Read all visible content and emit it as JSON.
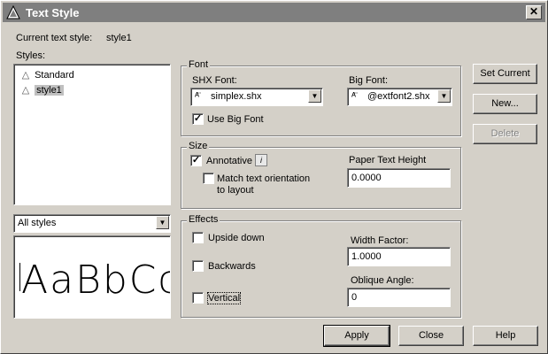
{
  "window": {
    "title": "Text Style"
  },
  "current": {
    "label": "Current text style:",
    "value": "style1"
  },
  "styles": {
    "label": "Styles:",
    "items": [
      {
        "label": "Standard"
      },
      {
        "label": "style1"
      }
    ],
    "filter_value": "All styles"
  },
  "preview": {
    "text": "AaBbCc"
  },
  "font": {
    "group_label": "Font",
    "shx_label": "SHX Font:",
    "shx_value": "simplex.shx",
    "big_label": "Big Font:",
    "big_value": "@extfont2.shx",
    "use_big_font_label": "Use Big Font",
    "use_big_font_checked": true
  },
  "size": {
    "group_label": "Size",
    "annotative_label": "Annotative",
    "annotative_checked": true,
    "match_label_1": "Match text orientation",
    "match_label_2": "to layout",
    "match_checked": false,
    "paper_height_label": "Paper Text Height",
    "paper_height_value": "0.0000"
  },
  "effects": {
    "group_label": "Effects",
    "upside_down_label": "Upside down",
    "backwards_label": "Backwards",
    "vertical_label": "Vertical",
    "width_factor_label": "Width Factor:",
    "width_factor_value": "1.0000",
    "oblique_label": "Oblique Angle:",
    "oblique_value": "0"
  },
  "buttons": {
    "set_current": "Set Current",
    "new": "New...",
    "delete": "Delete",
    "apply": "Apply",
    "close": "Close",
    "help": "Help"
  },
  "colors": {
    "titlebar": "#7f7f7f",
    "face": "#d4d0c8"
  }
}
